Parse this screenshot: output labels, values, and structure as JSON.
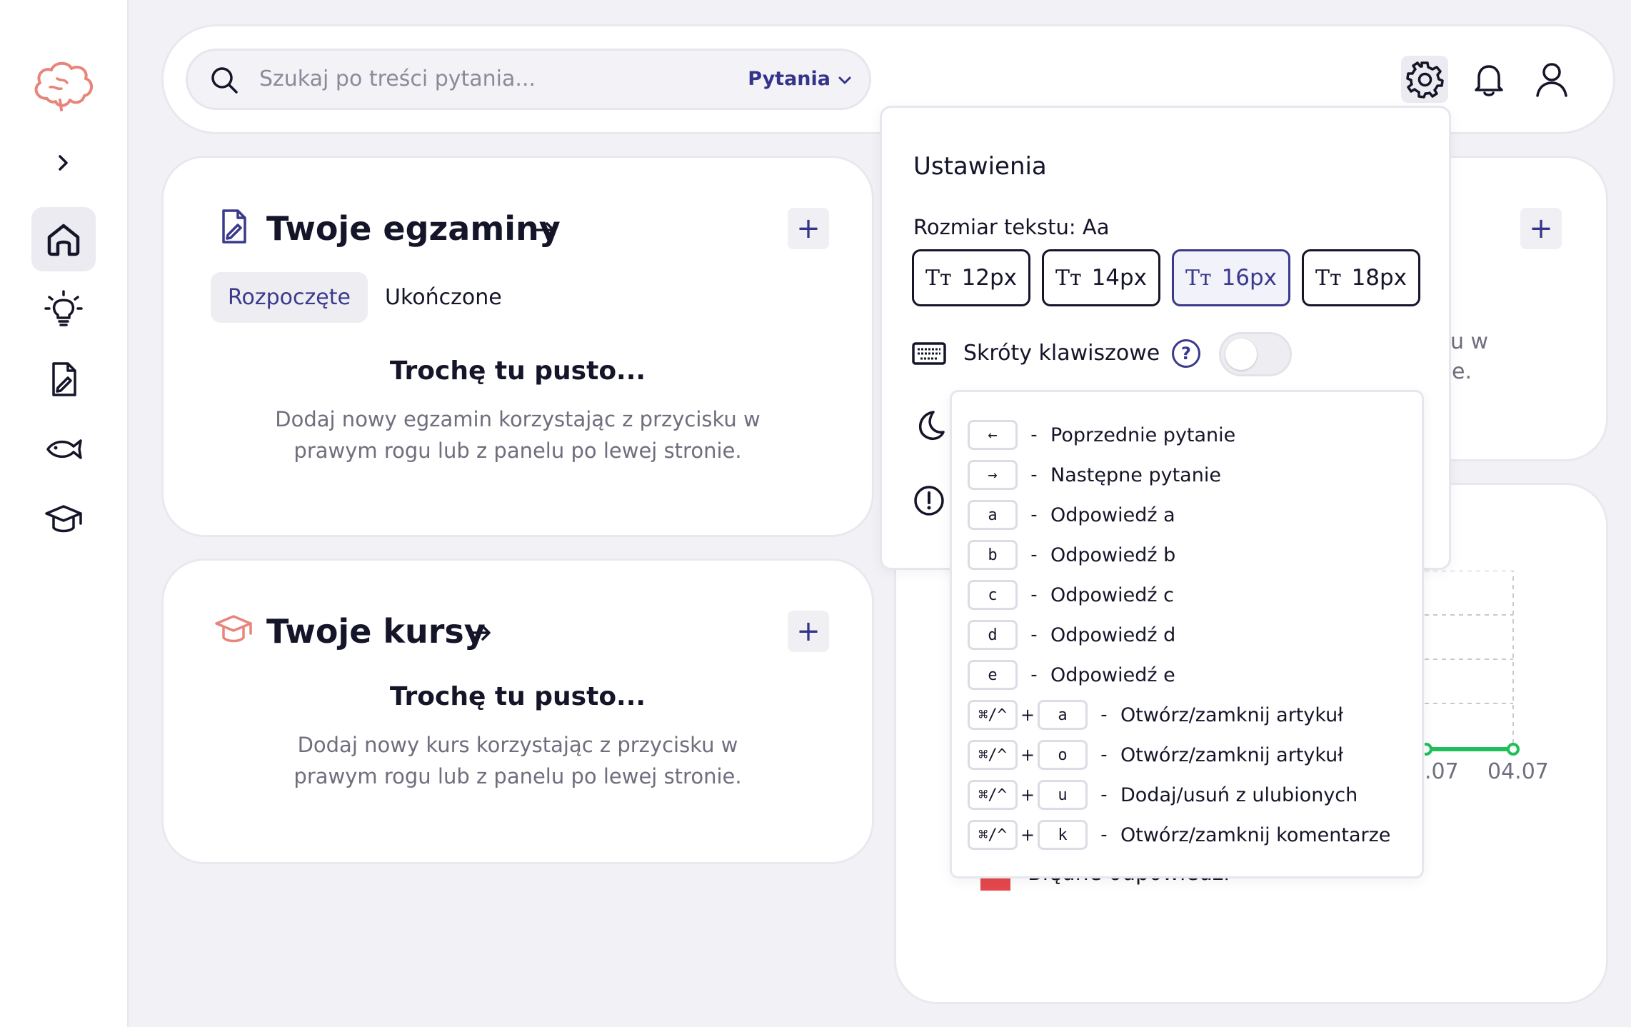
{
  "search": {
    "placeholder": "Szukaj po treści pytania...",
    "filter": "Pytania"
  },
  "exams": {
    "title": "Twoje egzaminy",
    "tabs": [
      "Rozpoczęte",
      "Ukończone"
    ],
    "empty_title": "Trochę tu pusto...",
    "empty_line1": "Dodaj nowy egzamin korzystając z przycisku w",
    "empty_line2": "prawym rogu lub z panelu po lewej stronie."
  },
  "courses": {
    "title": "Twoje kursy",
    "empty_title": "Trochę tu pusto...",
    "empty_line1": "Dodaj nowy kurs korzystając z przycisku w",
    "empty_line2": "prawym rogu lub z panelu po lewej stronie."
  },
  "settings": {
    "title": "Ustawienia",
    "size_label": "Rozmiar tekstu: Aa",
    "tt_glyph": "Tт",
    "sizes": [
      "12px",
      "14px",
      "16px",
      "18px"
    ],
    "selected_size": "16px",
    "shortcuts_label": "Skróty klawiszowe",
    "help": "?",
    "shortcuts_enabled": false
  },
  "shortcuts": [
    {
      "mod": "",
      "key": "←",
      "label": "Poprzednie pytanie"
    },
    {
      "mod": "",
      "key": "→",
      "label": "Następne pytanie"
    },
    {
      "mod": "",
      "key": "a",
      "label": "Odpowiedź a"
    },
    {
      "mod": "",
      "key": "b",
      "label": "Odpowiedź b"
    },
    {
      "mod": "",
      "key": "c",
      "label": "Odpowiedź c"
    },
    {
      "mod": "",
      "key": "d",
      "label": "Odpowiedź d"
    },
    {
      "mod": "",
      "key": "e",
      "label": "Odpowiedź e"
    },
    {
      "mod": "⌘/^",
      "key": "a",
      "label": "Otwórz/zamknij artykuł"
    },
    {
      "mod": "⌘/^",
      "key": "o",
      "label": "Otwórz/zamknij artykuł"
    },
    {
      "mod": "⌘/^",
      "key": "u",
      "label": "Dodaj/usuń z ulubionych"
    },
    {
      "mod": "⌘/^",
      "key": "k",
      "label": "Otwórz/zamknij komentarze"
    }
  ],
  "shortcut_separators": {
    "plus": "+",
    "dash": "-"
  },
  "background_fragments": {
    "right_text_1": "u w",
    "right_text_2": "e.",
    "tick_1": ".07",
    "tick_2": "04.07",
    "legend_partial": "Błędne odpowiedzi"
  },
  "colors": {
    "accent": "#3a3a8c",
    "brand": "#e8857a",
    "chart_green": "#1fbf5a",
    "wrong_red": "#e5484d"
  }
}
